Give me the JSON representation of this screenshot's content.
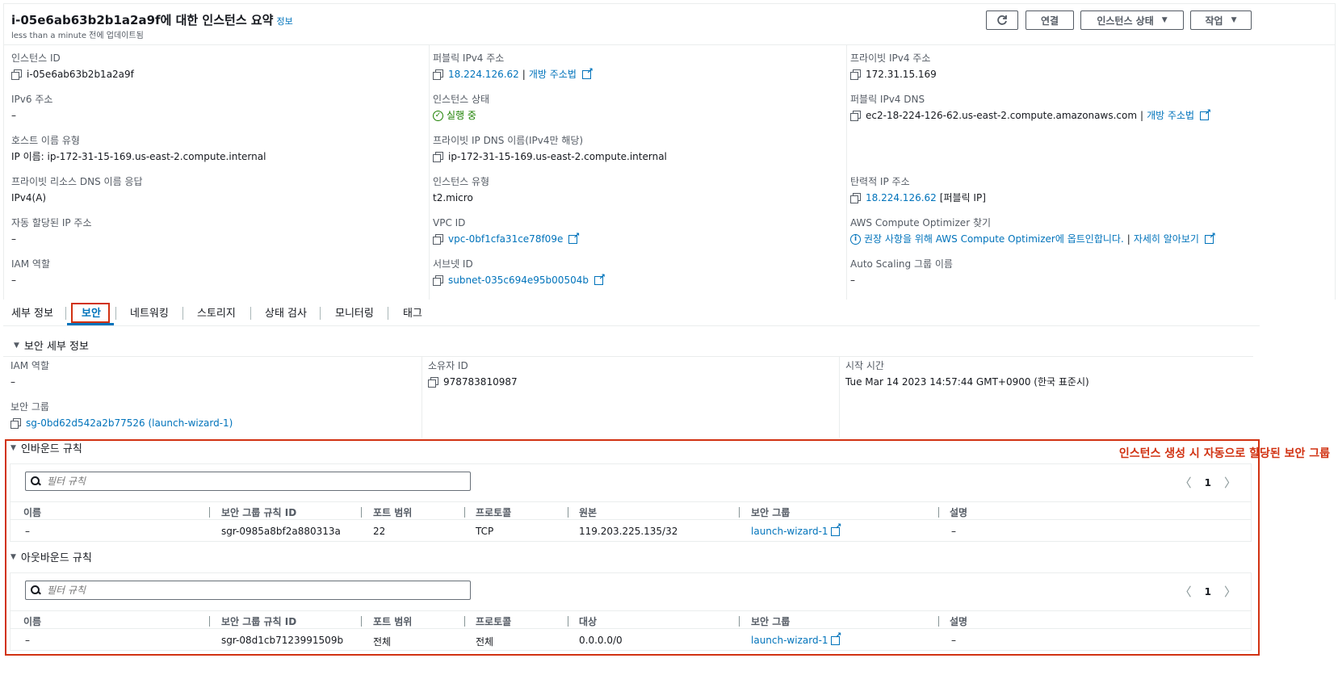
{
  "header": {
    "title": "i-05e6ab63b2b1a2a9f에 대한 인스턴스 요약",
    "info_link": "정보",
    "updated": "less than a minute 전에 업데이트됨",
    "refresh_icon": "refresh-icon",
    "connect_label": "연결",
    "instance_state_label": "인스턴스 상태",
    "actions_label": "작업"
  },
  "summary": {
    "instance_id_label": "인스턴스 ID",
    "instance_id": "i-05e6ab63b2b1a2a9f",
    "ipv6_label": "IPv6 주소",
    "ipv6": "–",
    "hostname_type_label": "호스트 이름 유형",
    "hostname_type": "IP 이름: ip-172-31-15-169.us-east-2.compute.internal",
    "private_dns_resp_label": "프라이빗 리소스 DNS 이름 응답",
    "private_dns_resp": "IPv4(A)",
    "auto_ip_label": "자동 할당된 IP 주소",
    "auto_ip": "–",
    "iam_role_label": "IAM 역할",
    "iam_role": "–",
    "public_ipv4_label": "퍼블릭 IPv4 주소",
    "public_ipv4": "18.224.126.62",
    "open_address": "개방 주소법",
    "state_label": "인스턴스 상태",
    "state": "실행 중",
    "private_ip_dns_label": "프라이빗 IP DNS 이름(IPv4만 해당)",
    "private_ip_dns": "ip-172-31-15-169.us-east-2.compute.internal",
    "instance_type_label": "인스턴스 유형",
    "instance_type": "t2.micro",
    "vpc_label": "VPC ID",
    "vpc": "vpc-0bf1cfa31ce78f09e",
    "subnet_label": "서브넷 ID",
    "subnet": "subnet-035c694e95b00504b",
    "private_ipv4_label": "프라이빗 IPv4 주소",
    "private_ipv4": "172.31.15.169",
    "public_dns_label": "퍼블릭 IPv4 DNS",
    "public_dns": "ec2-18-224-126-62.us-east-2.compute.amazonaws.com",
    "open_address2": "개방 주소법",
    "elastic_ip_label": "탄력적 IP 주소",
    "elastic_ip": "18.224.126.62",
    "elastic_ip_suffix": "[퍼블릭 IP]",
    "optimizer_label": "AWS Compute Optimizer 찾기",
    "optimizer_text": "권장 사항을 위해 AWS Compute Optimizer에 옵트인합니다.",
    "optimizer_more": "자세히 알아보기",
    "asg_label": "Auto Scaling 그룹 이름",
    "asg": "–",
    "separator": "|"
  },
  "tabs": [
    "세부 정보",
    "보안",
    "네트워킹",
    "스토리지",
    "상태 검사",
    "모니터링",
    "태그"
  ],
  "security": {
    "section_title": "보안 세부 정보",
    "iam_role_label": "IAM 역할",
    "iam_role": "–",
    "owner_label": "소유자 ID",
    "owner": "978783810987",
    "launch_time_label": "시작 시간",
    "launch_time": "Tue Mar 14 2023 14:57:44 GMT+0900 (한국 표준시)",
    "sg_label": "보안 그룹",
    "sg": "sg-0bd62d542a2b77526 (launch-wizard-1)"
  },
  "annotation": "인스턴스 생성 시 자동으로 할당된 보안 그룹",
  "inbound": {
    "title": "인바운드 규칙",
    "filter_placeholder": "필터 규칙",
    "page": "1",
    "columns": [
      "이름",
      "보안 그룹 규칙 ID",
      "포트 범위",
      "프로토콜",
      "원본",
      "보안 그룹",
      "설명"
    ],
    "row": [
      "–",
      "sgr-0985a8bf2a880313a",
      "22",
      "TCP",
      "119.203.225.135/32",
      "launch-wizard-1",
      "–"
    ]
  },
  "outbound": {
    "title": "아웃바운드 규칙",
    "filter_placeholder": "필터 규칙",
    "page": "1",
    "columns": [
      "이름",
      "보안 그룹 규칙 ID",
      "포트 범위",
      "프로토콜",
      "대상",
      "보안 그룹",
      "설명"
    ],
    "row": [
      "–",
      "sgr-08d1cb7123991509b",
      "전체",
      "전체",
      "0.0.0.0/0",
      "launch-wizard-1",
      "–"
    ]
  }
}
